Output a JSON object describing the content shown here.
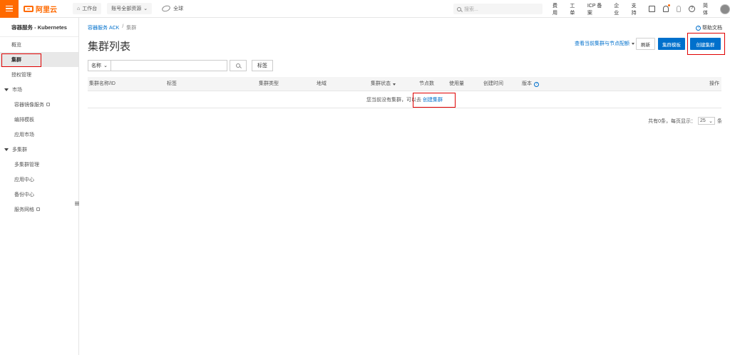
{
  "topbar": {
    "logo_text": "阿里云",
    "home": "工作台",
    "resource": "账号全部资源",
    "region": "全球",
    "search_placeholder": "搜索...",
    "links": [
      "费用",
      "工单",
      "ICP 备案",
      "企业",
      "支持"
    ],
    "lang": "简体"
  },
  "sidebar": {
    "title": "容器服务 - Kubernetes",
    "items": [
      {
        "label": "概览"
      },
      {
        "label": "集群",
        "active": true
      },
      {
        "label": "授权管理"
      }
    ],
    "groups": [
      {
        "label": "市场",
        "items": [
          {
            "label": "容器镜像服务",
            "external": true
          },
          {
            "label": "编排模板"
          },
          {
            "label": "应用市场"
          }
        ]
      },
      {
        "label": "多集群",
        "items": [
          {
            "label": "多集群管理"
          },
          {
            "label": "应用中心"
          },
          {
            "label": "备份中心"
          },
          {
            "label": "服务网格",
            "external": true
          }
        ]
      }
    ]
  },
  "main": {
    "breadcrumb": [
      "容器服务 ACK",
      "/",
      "集群"
    ],
    "help_doc": "帮助文档",
    "title": "集群列表",
    "view_link": "查看当前集群与节点配额",
    "refresh": "刷新",
    "template": "集群模板",
    "create": "创建集群",
    "filter": {
      "select_value": "名称",
      "input_value": "",
      "tag_btn": "标签"
    },
    "table": {
      "columns": [
        "集群名称/ID",
        "标签",
        "集群类型",
        "地域",
        "集群状态",
        "节点数",
        "使用量",
        "创建时间",
        "版本",
        "操作"
      ],
      "empty_text": "您当前没有集群，可以去",
      "empty_link": "创建集群"
    },
    "pagination": {
      "prefix": "共有0条，每页显示：",
      "page_size": "25",
      "suffix": "条"
    }
  },
  "colors": {
    "brand_orange": "#ff6a00",
    "primary_blue": "#0070cc",
    "highlight_red": "#e00000"
  }
}
